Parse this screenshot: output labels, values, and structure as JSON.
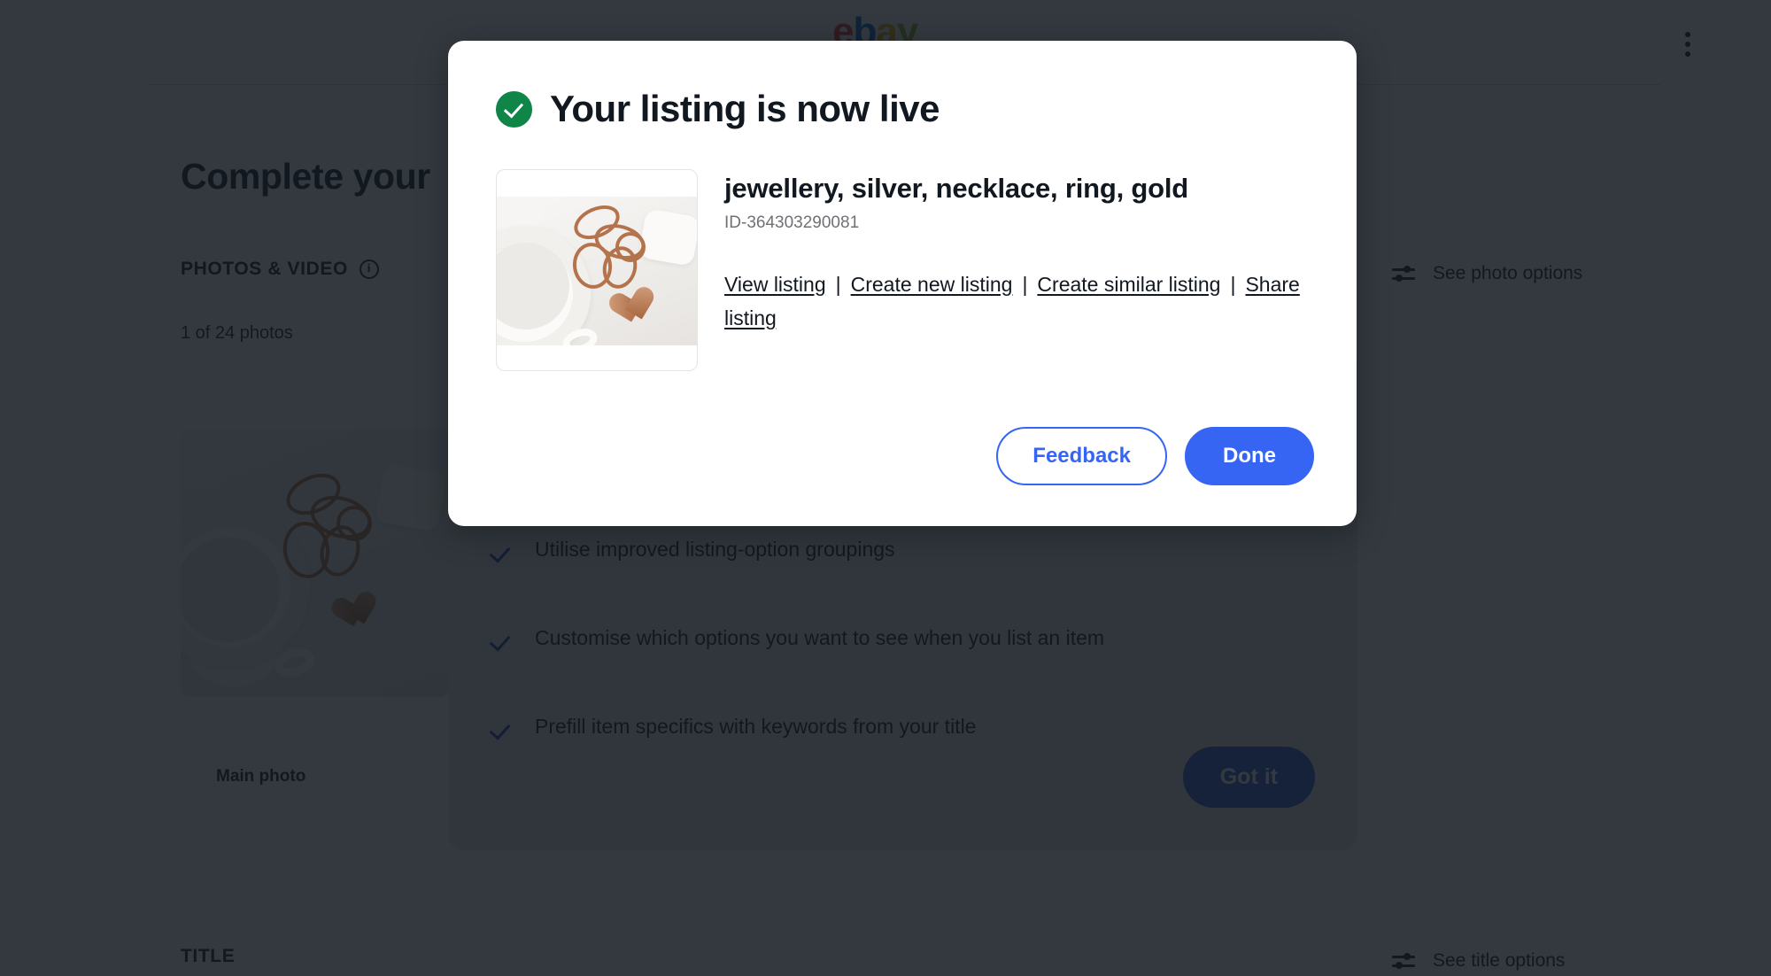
{
  "background": {
    "brand": {
      "letters": [
        "e",
        "b",
        "a",
        "y"
      ]
    },
    "menu_icon": "kebab-menu-icon",
    "page_title": "Complete your",
    "photos_section": {
      "label": "PHOTOS & VIDEO",
      "info_icon": "info-icon",
      "count_text": "1 of 24 photos",
      "main_photo_caption": "Main photo",
      "options_link": "See photo options",
      "options_icon": "sliders-icon"
    },
    "title_section": {
      "label": "TITLE",
      "options_link": "See title options",
      "options_icon": "sliders-icon"
    },
    "onboarding": {
      "items": [
        "Utilise improved listing-option groupings",
        "Customise which options you want to see when you list an item",
        "Prefill item specifics with keywords from your title"
      ],
      "check_icon": "check-icon",
      "cta_label": "Got it"
    }
  },
  "modal": {
    "status_icon": "success-check-icon",
    "title": "Your listing is now live",
    "listing": {
      "thumbnail_alt": "rose-gold-heart-pendant-necklace-photo",
      "title": "jewellery, silver, necklace, ring, gold",
      "id": "ID-364303290081",
      "links": [
        "View listing",
        "Create new listing",
        "Create similar listing",
        "Share listing"
      ],
      "separator": "|"
    },
    "buttons": {
      "secondary": "Feedback",
      "primary": "Done"
    }
  },
  "colors": {
    "success_green": "#108548",
    "primary_blue": "#3665f3",
    "link_text": "#111820",
    "muted_text": "#6f7174",
    "scrim": "rgba(18,24,32,0.86)"
  }
}
